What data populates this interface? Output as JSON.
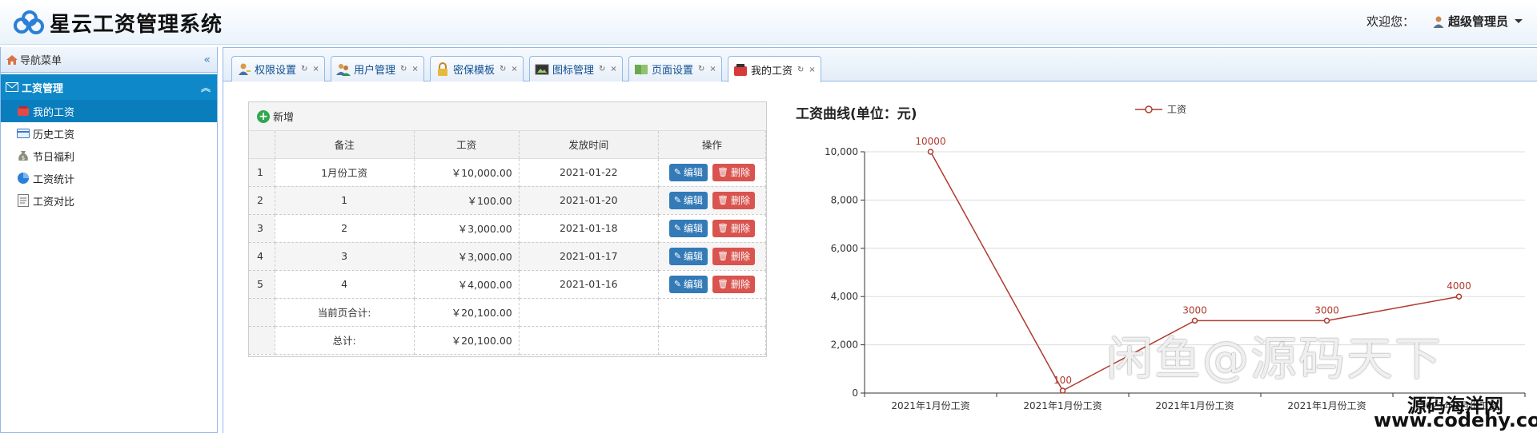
{
  "header": {
    "app_title": "星云工资管理系统",
    "welcome": "欢迎您：",
    "user_name": "超级管理员"
  },
  "sidebar": {
    "title": "导航菜单",
    "collapse_glyph": "«",
    "group_label": "工资管理",
    "items": [
      {
        "label": "我的工资",
        "icon": "wallet-icon",
        "active": true
      },
      {
        "label": "历史工资",
        "icon": "card-icon",
        "active": false
      },
      {
        "label": "节日福利",
        "icon": "money-bag-icon",
        "active": false
      },
      {
        "label": "工资统计",
        "icon": "pie-chart-icon",
        "active": false
      },
      {
        "label": "工资对比",
        "icon": "document-icon",
        "active": false
      }
    ]
  },
  "tabs": [
    {
      "label": "权限设置"
    },
    {
      "label": "用户管理"
    },
    {
      "label": "密保模板"
    },
    {
      "label": "图标管理"
    },
    {
      "label": "页面设置"
    },
    {
      "label": "我的工资"
    }
  ],
  "tab_controls": {
    "refresh": "↻",
    "close": "×"
  },
  "table": {
    "add_label": "新增",
    "columns": [
      "备注",
      "工资",
      "发放时间",
      "操作"
    ],
    "rows": [
      {
        "idx": "1",
        "note": "1月份工资",
        "salary": "￥10,000.00",
        "date": "2021-01-22"
      },
      {
        "idx": "2",
        "note": "1",
        "salary": "￥100.00",
        "date": "2021-01-20"
      },
      {
        "idx": "3",
        "note": "2",
        "salary": "￥3,000.00",
        "date": "2021-01-18"
      },
      {
        "idx": "4",
        "note": "3",
        "salary": "￥3,000.00",
        "date": "2021-01-17"
      },
      {
        "idx": "5",
        "note": "4",
        "salary": "￥4,000.00",
        "date": "2021-01-16"
      }
    ],
    "edit_label": "编辑",
    "delete_label": "删除",
    "page_total_label": "当前页合计:",
    "page_total_value": "￥20,100.00",
    "total_label": "总计:",
    "total_value": "￥20,100.00"
  },
  "chart_data": {
    "type": "line",
    "title": "工资曲线(单位：元)",
    "categories": [
      "2021年1月份工资",
      "2021年1月份工资",
      "2021年1月份工资",
      "2021年1月份工资",
      "2021年1月份工资"
    ],
    "series": [
      {
        "name": "工资",
        "values": [
          10000,
          100,
          3000,
          3000,
          4000
        ]
      }
    ],
    "ylim": [
      0,
      10000
    ],
    "yticks": [
      "0",
      "2,000",
      "4,000",
      "6,000",
      "8,000",
      "10,000"
    ],
    "legend_position": "top",
    "grid": true,
    "line_color": "#b03a2e"
  },
  "watermarks": {
    "main": "闲鱼@源码天下",
    "brand": "源码海洋网",
    "url": "www.codehy.com"
  }
}
